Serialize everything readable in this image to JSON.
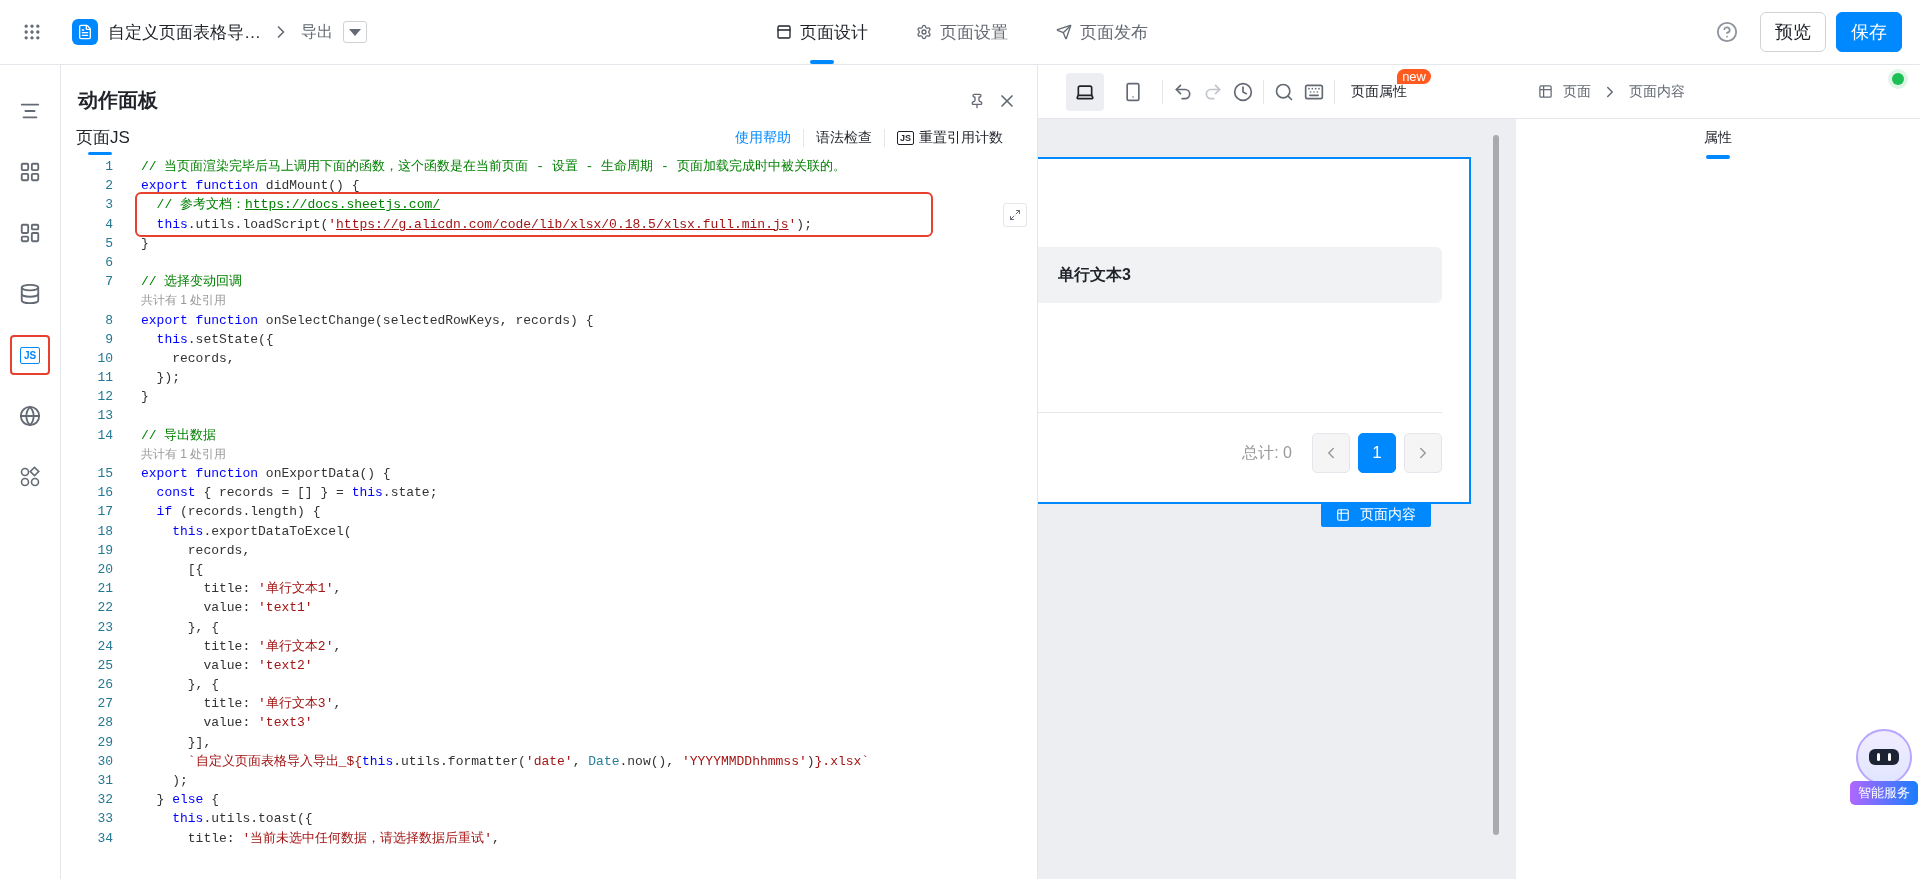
{
  "topbar": {
    "app_title": "自定义页面表格导…",
    "breadcrumb": "导出",
    "tabs": [
      {
        "label": "页面设计",
        "selected": true
      },
      {
        "label": "页面设置",
        "selected": false
      },
      {
        "label": "页面发布",
        "selected": false
      }
    ],
    "buttons": [
      {
        "label": "预览",
        "kind": "secondary"
      },
      {
        "label": "保存",
        "kind": "primary"
      }
    ]
  },
  "rail": [
    {
      "selected": false,
      "outlined": false
    },
    {
      "selected": false,
      "outlined": false
    },
    {
      "selected": false,
      "outlined": false
    },
    {
      "selected": false,
      "outlined": false
    },
    {
      "selected": true,
      "outlined": true,
      "label": "JS"
    },
    {
      "selected": false,
      "outlined": false
    },
    {
      "selected": false,
      "outlined": false
    }
  ],
  "action_panel": {
    "title": "动作面板",
    "tab": "页面JS",
    "links": [
      {
        "label": "使用帮助",
        "kind": "link"
      },
      {
        "label": "语法检查",
        "kind": "plain"
      },
      {
        "label": "重置引用计数",
        "kind": "badge",
        "badge": "JS"
      }
    ],
    "code_blocks": [
      {
        "kind": "plain",
        "lines": [
          {
            "number": "1",
            "tokens": [
              {
                "kind": "comment",
                "text": "// 当页面渲染完毕后马上调用下面的函数，这个函数是在当前页面 - 设置 - 生命周期 - 页面加载完成时中被关联的。"
              }
            ]
          },
          {
            "number": "2",
            "tokens": [
              {
                "kind": "keyword",
                "text": "export function"
              },
              {
                "kind": "plain",
                "text": " didMount() {"
              }
            ]
          }
        ]
      },
      {
        "kind": "annotated",
        "lines": [
          {
            "number": "3",
            "tokens": [
              {
                "kind": "comment",
                "text": "  // 参考文档："
              },
              {
                "kind": "link",
                "text": "https://docs.sheetjs.com/"
              }
            ]
          },
          {
            "number": "4",
            "tokens": [
              {
                "kind": "keyword",
                "text": "  this"
              },
              {
                "kind": "plain",
                "text": ".utils.loadScript("
              },
              {
                "kind": "string",
                "text": "'"
              },
              {
                "kind": "string-link",
                "text": "https://g.alicdn.com/code/lib/xlsx/0.18.5/xlsx.full.min.js"
              },
              {
                "kind": "string",
                "text": "'"
              },
              {
                "kind": "plain",
                "text": ");"
              }
            ]
          }
        ]
      },
      {
        "kind": "plain",
        "lines": [
          {
            "number": "5",
            "tokens": [
              {
                "kind": "plain",
                "text": "}"
              }
            ]
          },
          {
            "number": "6"
          },
          {
            "number": "7",
            "tokens": [
              {
                "kind": "comment",
                "text": "// 选择变动回调"
              }
            ]
          },
          {
            "tokens": [
              {
                "kind": "hint",
                "text": "共计有 1 处引用"
              }
            ]
          },
          {
            "number": "8",
            "tokens": [
              {
                "kind": "keyword",
                "text": "export function"
              },
              {
                "kind": "plain",
                "text": " onSelectChange(selectedRowKeys, records) {"
              }
            ]
          },
          {
            "number": "9",
            "tokens": [
              {
                "kind": "keyword",
                "text": "  this"
              },
              {
                "kind": "plain",
                "text": ".setState({"
              }
            ]
          },
          {
            "number": "10",
            "tokens": [
              {
                "kind": "plain",
                "text": "    records,"
              }
            ]
          },
          {
            "number": "11",
            "tokens": [
              {
                "kind": "plain",
                "text": "  });"
              }
            ]
          },
          {
            "number": "12",
            "tokens": [
              {
                "kind": "plain",
                "text": "}"
              }
            ]
          },
          {
            "number": "13"
          },
          {
            "number": "14",
            "tokens": [
              {
                "kind": "comment",
                "text": "// 导出数据"
              }
            ]
          },
          {
            "tokens": [
              {
                "kind": "hint",
                "text": "共计有 1 处引用"
              }
            ]
          },
          {
            "number": "15",
            "tokens": [
              {
                "kind": "keyword",
                "text": "export function"
              },
              {
                "kind": "plain",
                "text": " onExportData() {"
              }
            ]
          },
          {
            "number": "16",
            "tokens": [
              {
                "kind": "keyword",
                "text": "  const"
              },
              {
                "kind": "plain",
                "text": " { records = [] } = "
              },
              {
                "kind": "keyword",
                "text": "this"
              },
              {
                "kind": "plain",
                "text": ".state;"
              }
            ]
          },
          {
            "number": "17",
            "tokens": [
              {
                "kind": "keyword",
                "text": "  if"
              },
              {
                "kind": "plain",
                "text": " (records.length) {"
              }
            ]
          },
          {
            "number": "18",
            "tokens": [
              {
                "kind": "keyword",
                "text": "    this"
              },
              {
                "kind": "plain",
                "text": ".exportDataToExcel("
              }
            ]
          },
          {
            "number": "19",
            "tokens": [
              {
                "kind": "plain",
                "text": "      records,"
              }
            ]
          },
          {
            "number": "20",
            "tokens": [
              {
                "kind": "plain",
                "text": "      [{"
              }
            ]
          },
          {
            "number": "21",
            "tokens": [
              {
                "kind": "plain",
                "text": "        title: "
              },
              {
                "kind": "string",
                "text": "'单行文本1'"
              },
              {
                "kind": "plain",
                "text": ","
              }
            ]
          },
          {
            "number": "22",
            "tokens": [
              {
                "kind": "plain",
                "text": "        value: "
              },
              {
                "kind": "string",
                "text": "'text1'"
              }
            ]
          },
          {
            "number": "23",
            "tokens": [
              {
                "kind": "plain",
                "text": "      }, {"
              }
            ]
          },
          {
            "number": "24",
            "tokens": [
              {
                "kind": "plain",
                "text": "        title: "
              },
              {
                "kind": "string",
                "text": "'单行文本2'"
              },
              {
                "kind": "plain",
                "text": ","
              }
            ]
          },
          {
            "number": "25",
            "tokens": [
              {
                "kind": "plain",
                "text": "        value: "
              },
              {
                "kind": "string",
                "text": "'text2'"
              }
            ]
          },
          {
            "number": "26",
            "tokens": [
              {
                "kind": "plain",
                "text": "      }, {"
              }
            ]
          },
          {
            "number": "27",
            "tokens": [
              {
                "kind": "plain",
                "text": "        title: "
              },
              {
                "kind": "string",
                "text": "'单行文本3'"
              },
              {
                "kind": "plain",
                "text": ","
              }
            ]
          },
          {
            "number": "28",
            "tokens": [
              {
                "kind": "plain",
                "text": "        value: "
              },
              {
                "kind": "string",
                "text": "'text3'"
              }
            ]
          },
          {
            "number": "29",
            "tokens": [
              {
                "kind": "plain",
                "text": "      }],"
              }
            ]
          },
          {
            "number": "30",
            "tokens": [
              {
                "kind": "string",
                "text": "      `自定义页面表格导入导出_${"
              },
              {
                "kind": "keyword",
                "text": "this"
              },
              {
                "kind": "plain",
                "text": ".utils.formatter("
              },
              {
                "kind": "string",
                "text": "'date'"
              },
              {
                "kind": "plain",
                "text": ", "
              },
              {
                "kind": "type",
                "text": "Date"
              },
              {
                "kind": "plain",
                "text": ".now(), "
              },
              {
                "kind": "string",
                "text": "'YYYYMMDDhhmmss'"
              },
              {
                "kind": "plain",
                "text": ")"
              },
              {
                "kind": "string",
                "text": "}.xlsx`"
              }
            ]
          },
          {
            "number": "31",
            "tokens": [
              {
                "kind": "plain",
                "text": "    );"
              }
            ]
          },
          {
            "number": "32",
            "tokens": [
              {
                "kind": "plain",
                "text": "  } "
              },
              {
                "kind": "keyword",
                "text": "else"
              },
              {
                "kind": "plain",
                "text": " {"
              }
            ]
          },
          {
            "number": "33",
            "tokens": [
              {
                "kind": "keyword",
                "text": "    this"
              },
              {
                "kind": "plain",
                "text": ".utils.toast({"
              }
            ]
          },
          {
            "number": "34",
            "tokens": [
              {
                "kind": "plain",
                "text": "      title: "
              },
              {
                "kind": "string",
                "text": "'当前未选中任何数据，请选择数据后重试'"
              },
              {
                "kind": "plain",
                "text": ","
              }
            ]
          }
        ]
      }
    ]
  },
  "canvas_toolbar": {
    "devices": [
      {
        "selected": true
      },
      {
        "selected": false
      }
    ],
    "page_props": "页面属性",
    "new_badge": "new"
  },
  "canvas": {
    "table_header": "单行文本3",
    "total": "总计: 0",
    "pages": [
      {
        "label": "1",
        "selected": true
      }
    ],
    "component_tag": "页面内容"
  },
  "right_panel": {
    "breadcrumb": [
      "页面",
      "页面内容"
    ],
    "tabs": [
      {
        "label": "属性",
        "selected": true
      }
    ],
    "online": true
  },
  "assistant": {
    "label": "智能服务"
  }
}
